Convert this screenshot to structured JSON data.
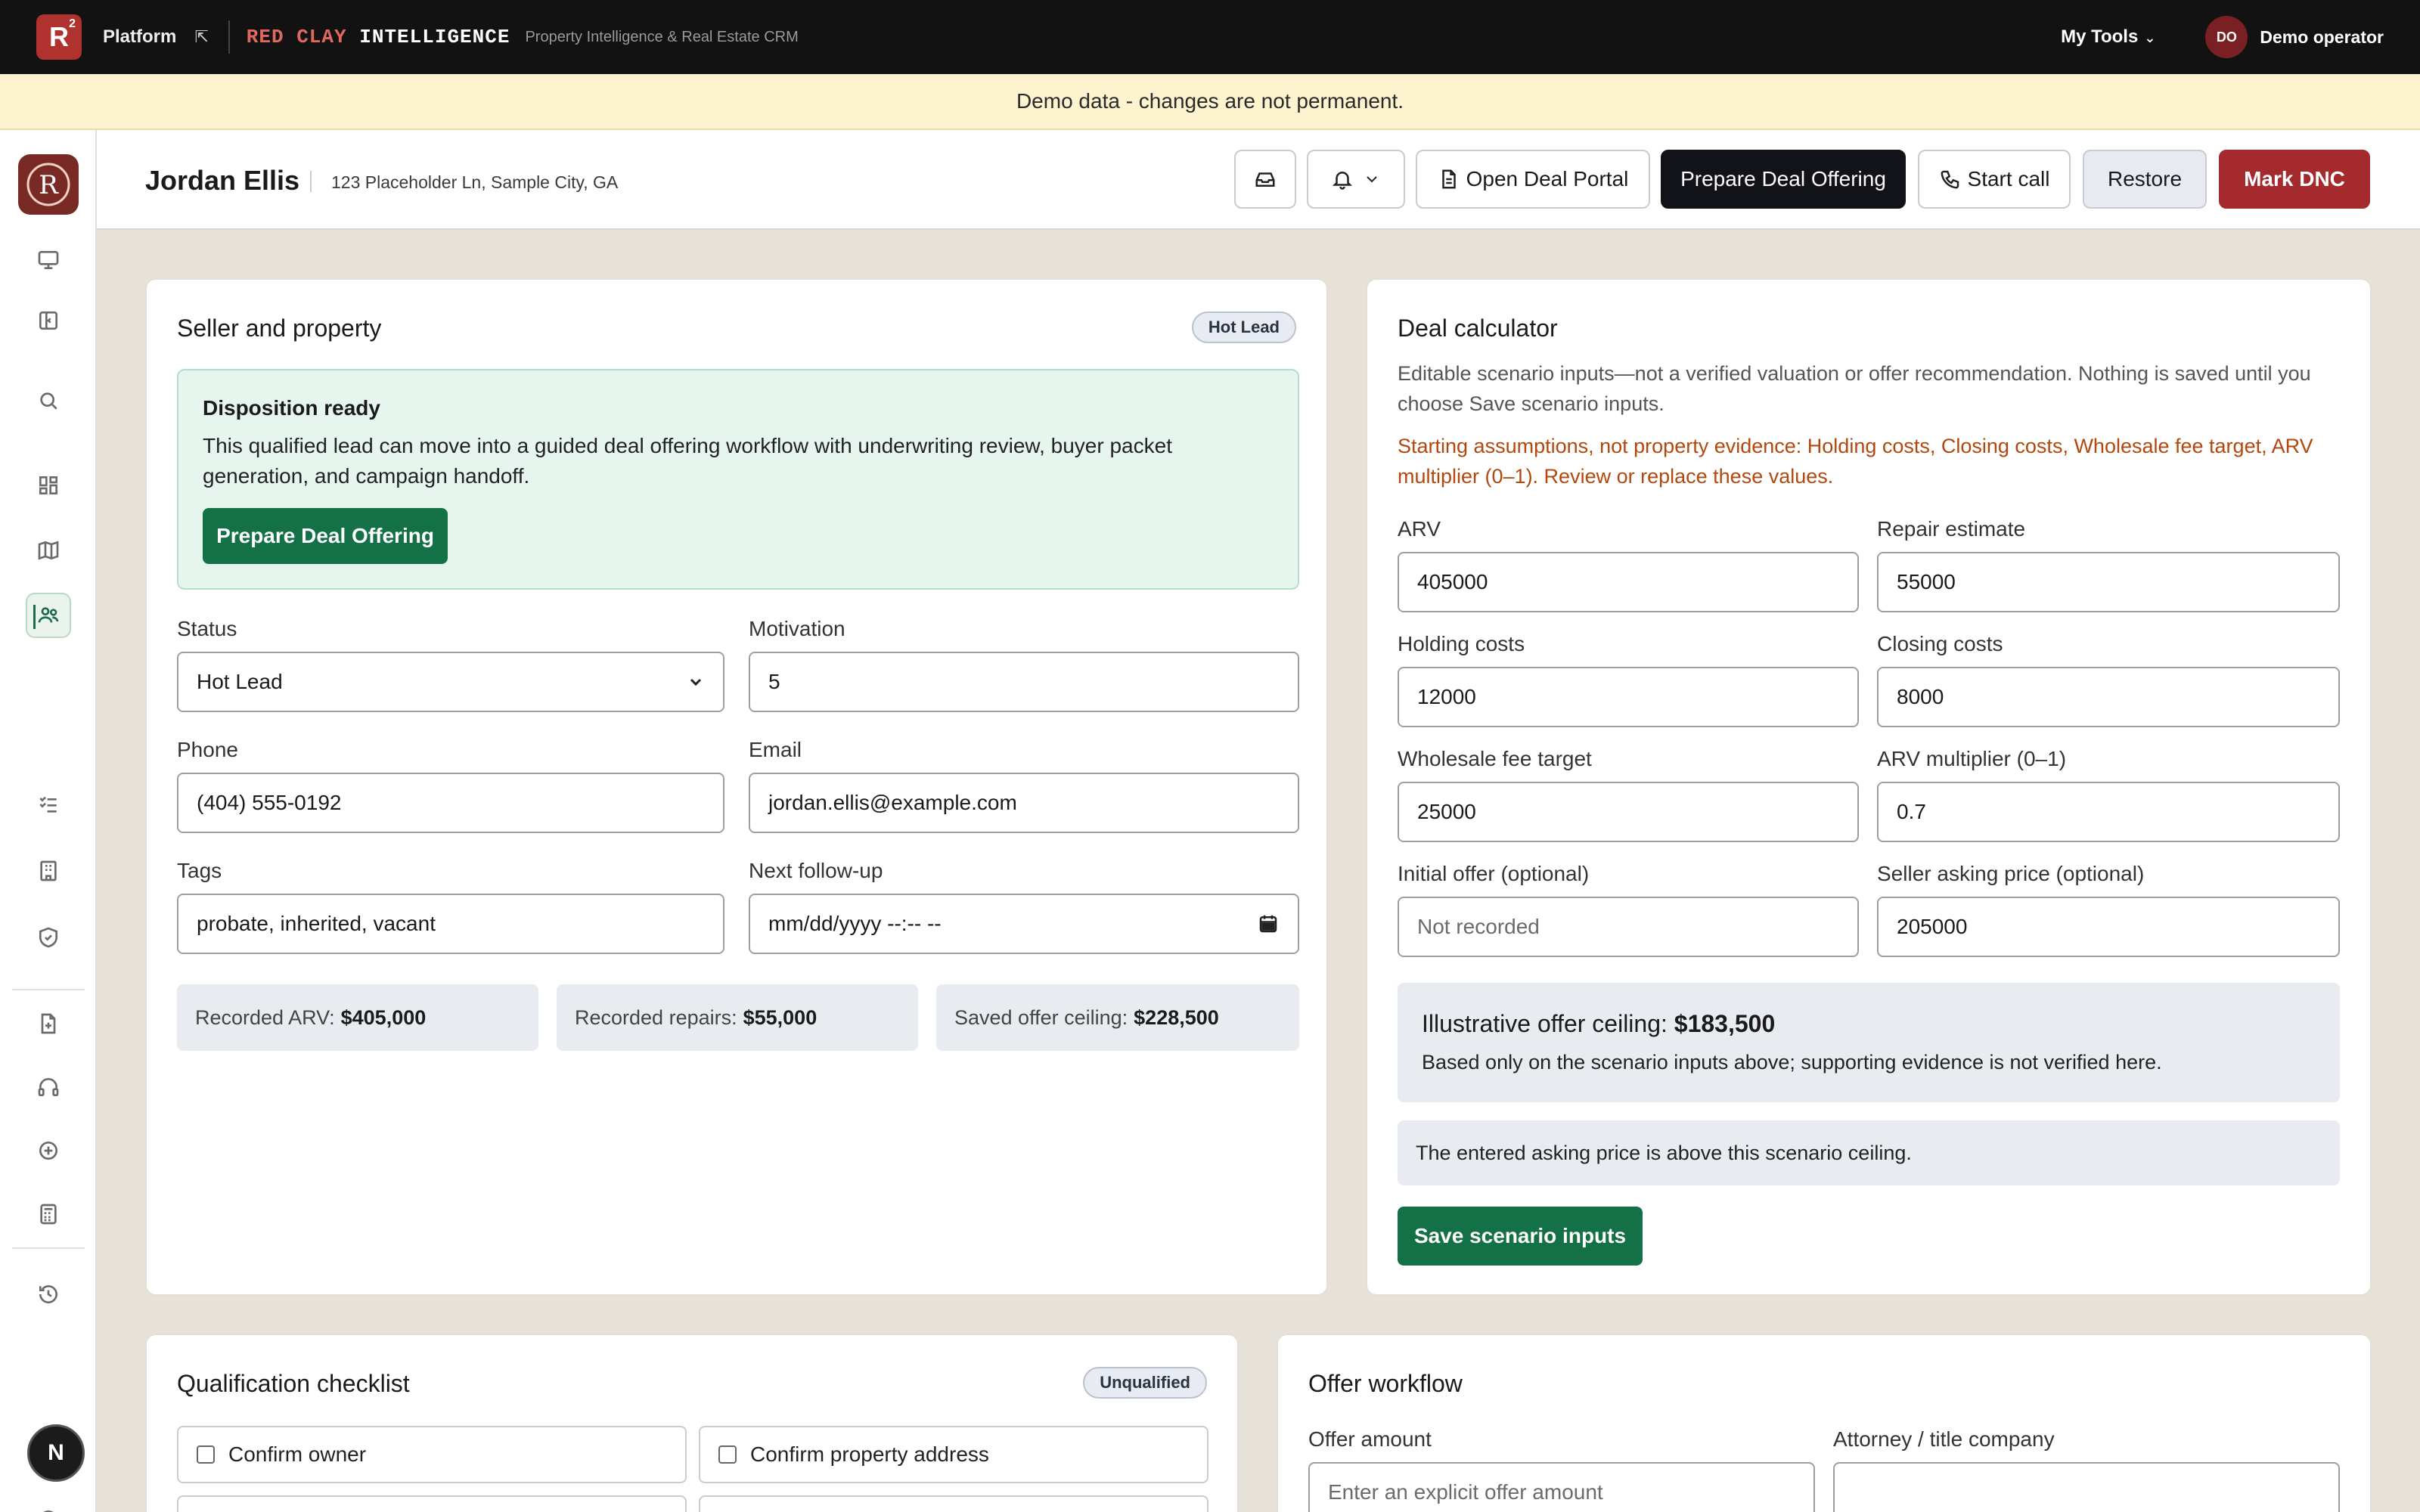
{
  "topbar": {
    "logo_letter": "R",
    "logo_sup": "2",
    "platform_label": "Platform",
    "brand_red": "RED CLAY",
    "brand_white": "INTELLIGENCE",
    "brand_sub": "Property Intelligence & Real Estate CRM",
    "my_tools": "My Tools",
    "avatar_initials": "DO",
    "operator": "Demo operator"
  },
  "banner": "Demo data - changes are not permanent.",
  "sidebar": {
    "icons": [
      "monitor-icon",
      "panel-icon",
      "search-icon",
      "grid-icon",
      "map-icon",
      "users-icon",
      "checklist-icon",
      "building-icon",
      "shield-icon",
      "file-plus-icon",
      "headphones-icon",
      "plus-circle-icon",
      "calculator-icon",
      "history-icon",
      "help-icon"
    ],
    "bottom_letter": "N"
  },
  "header": {
    "name": "Jordan Ellis",
    "address": "123 Placeholder Ln, Sample City, GA",
    "open_portal": "Open Deal Portal",
    "prepare": "Prepare Deal Offering",
    "start_call": "Start call",
    "restore": "Restore",
    "mark_dnc": "Mark DNC"
  },
  "seller": {
    "title": "Seller and property",
    "badge": "Hot Lead",
    "disp_title": "Disposition ready",
    "disp_text": "This qualified lead can move into a guided deal offering workflow with underwriting review, buyer packet generation, and campaign handoff.",
    "disp_button": "Prepare Deal Offering",
    "status_label": "Status",
    "status_value": "Hot Lead",
    "motivation_label": "Motivation",
    "motivation_value": "5",
    "phone_label": "Phone",
    "phone_value": "(404) 555-0192",
    "email_label": "Email",
    "email_value": "jordan.ellis@example.com",
    "tags_label": "Tags",
    "tags_value": "probate, inherited, vacant",
    "followup_label": "Next follow-up",
    "followup_value": "mm/dd/yyyy --:-- --",
    "stat_arv_label": "Recorded ARV:",
    "stat_arv_value": "$405,000",
    "stat_repairs_label": "Recorded repairs:",
    "stat_repairs_value": "$55,000",
    "stat_ceiling_label": "Saved offer ceiling:",
    "stat_ceiling_value": "$228,500"
  },
  "calc": {
    "title": "Deal calculator",
    "intro": "Editable scenario inputs—not a verified valuation or offer recommendation. Nothing is saved until you choose Save scenario inputs.",
    "warning": "Starting assumptions, not property evidence: Holding costs, Closing costs, Wholesale fee target, ARV multiplier (0–1). Review or replace these values.",
    "arv_label": "ARV",
    "arv_value": "405000",
    "repair_label": "Repair estimate",
    "repair_value": "55000",
    "holding_label": "Holding costs",
    "holding_value": "12000",
    "closing_label": "Closing costs",
    "closing_value": "8000",
    "fee_label": "Wholesale fee target",
    "fee_value": "25000",
    "mult_label": "ARV multiplier (0–1)",
    "mult_value": "0.7",
    "initial_label": "Initial offer (optional)",
    "initial_placeholder": "Not recorded",
    "asking_label": "Seller asking price (optional)",
    "asking_value": "205000",
    "ceiling_label": "Illustrative offer ceiling:",
    "ceiling_value": "$183,500",
    "ceiling_note": "Based only on the scenario inputs above; supporting evidence is not verified here.",
    "asking_note": "The entered asking price is above this scenario ceiling.",
    "save_button": "Save scenario inputs"
  },
  "qual": {
    "title": "Qualification checklist",
    "badge": "Unqualified",
    "items": [
      "Confirm owner",
      "Confirm property address"
    ]
  },
  "offer": {
    "title": "Offer workflow",
    "amount_label": "Offer amount",
    "amount_placeholder": "Enter an explicit offer amount",
    "attorney_label": "Attorney / title company"
  }
}
